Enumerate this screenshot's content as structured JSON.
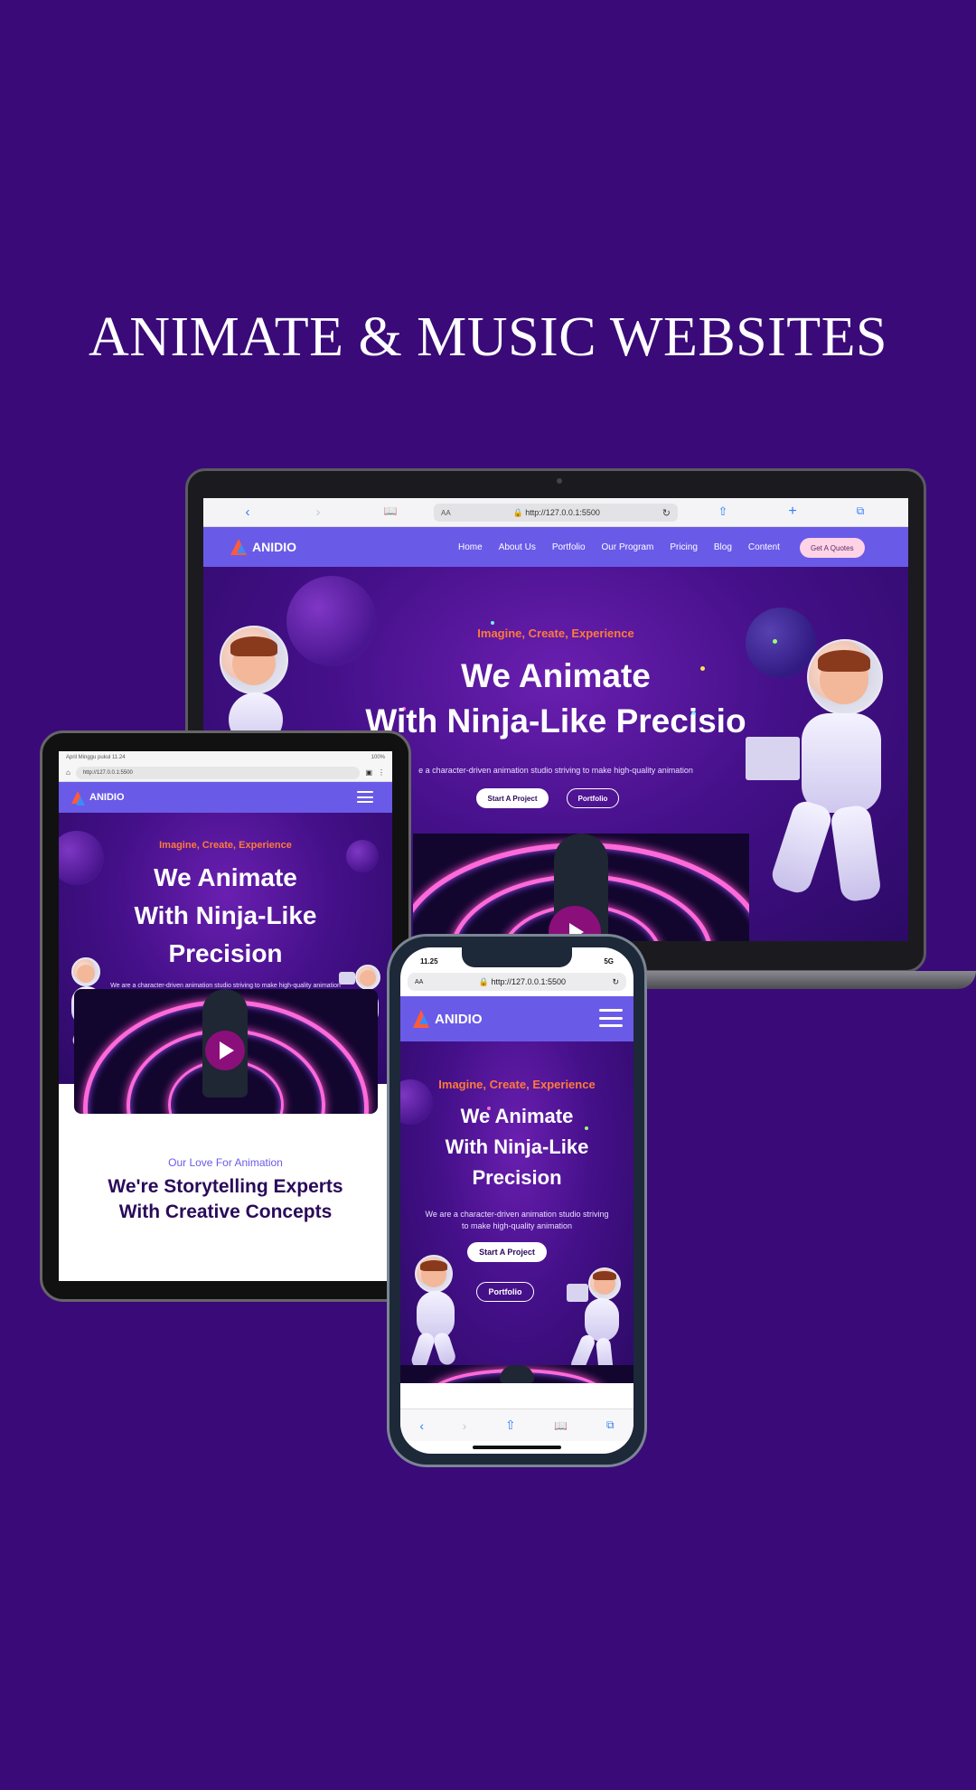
{
  "headline": "ANIMATE & MUSIC WEBSITES",
  "brand": {
    "name": "ANIDIO",
    "accent": "#6a5ae8",
    "tag_color": "#ff7a3a",
    "background": "#3a0a78"
  },
  "browser": {
    "url": "http://127.0.0.1:5500",
    "aa_label": "AA",
    "tablet_status_left": "April Minggu pukul 11.24",
    "tablet_status_right": "100%",
    "phone_time": "11.25",
    "phone_network": "5G",
    "icons": [
      "back-icon",
      "forward-icon",
      "bookmarks-icon",
      "lock-icon",
      "reload-icon",
      "share-icon",
      "new-tab-icon",
      "tabs-icon"
    ]
  },
  "nav": {
    "links": [
      "Home",
      "About Us",
      "Portfolio",
      "Our Program",
      "Pricing",
      "Blog",
      "Content"
    ],
    "quote_button": "Get A Quotes"
  },
  "hero": {
    "tagline": "Imagine, Create, Experience",
    "title_line1": "We Animate",
    "title_line2_laptop": "With Ninja-Like Precisio",
    "title_line2": "With Ninja-Like",
    "title_line3": "Precision",
    "subtitle_laptop": "e a character-driven animation studio striving to make high-quality animation",
    "subtitle_tablet": "We are a character-driven animation studio striving to make high-quality animation",
    "subtitle_phone_line1": "We are a character-driven animation studio striving",
    "subtitle_phone_line2": "to make high-quality animation",
    "primary_button": "Start A Project",
    "secondary_button": "Portfolio"
  },
  "section": {
    "kicker": "Our Love For Animation",
    "title": "We're Storytelling Experts",
    "title_cut": "With Creative Concepts"
  }
}
